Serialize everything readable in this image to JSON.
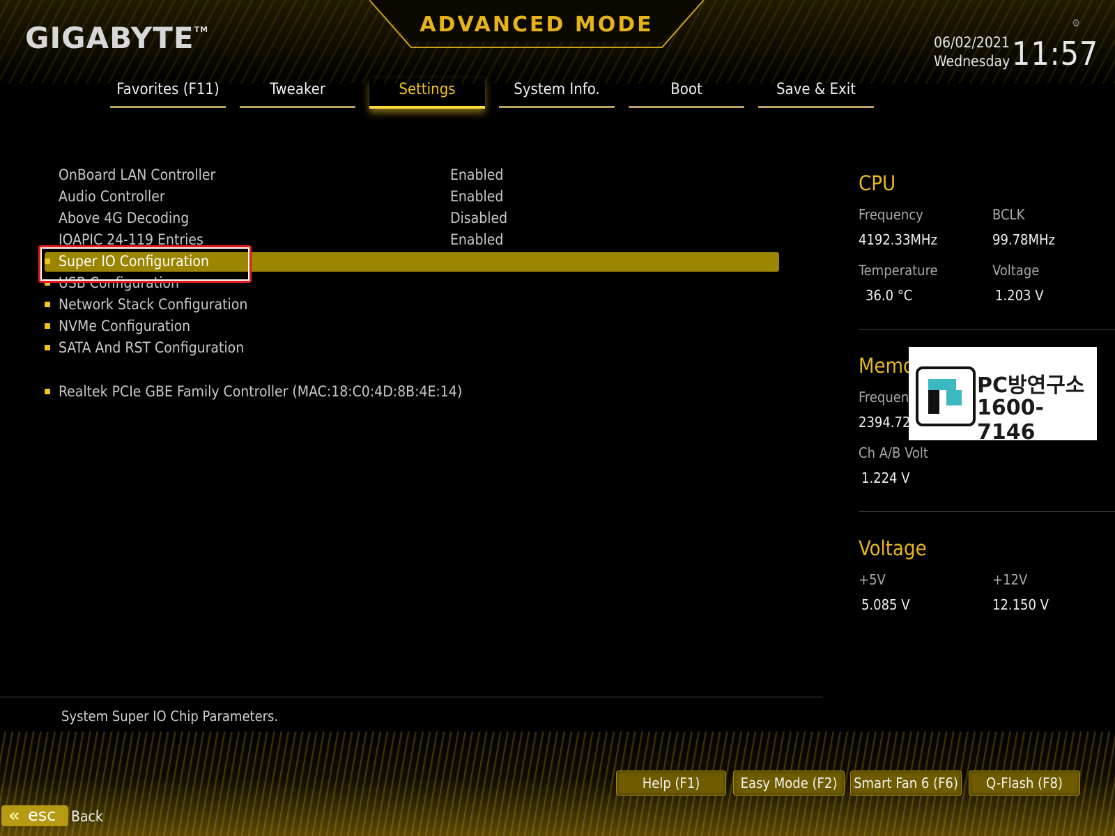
{
  "header": {
    "brand": "GIGABYTE",
    "brand_tm": "TM",
    "mode_title": "ADVANCED MODE",
    "date": "06/02/2021",
    "weekday": "Wednesday",
    "time": "11:57",
    "settings_icon": "gear-icon"
  },
  "tabs": [
    {
      "label": "Favorites (F11)",
      "active": false
    },
    {
      "label": "Tweaker",
      "active": false
    },
    {
      "label": "Settings",
      "active": true
    },
    {
      "label": "System Info.",
      "active": false
    },
    {
      "label": "Boot",
      "active": false
    },
    {
      "label": "Save & Exit",
      "active": false
    }
  ],
  "settings": {
    "items": [
      {
        "label": "OnBoard LAN Controller",
        "value": "Enabled"
      },
      {
        "label": "Audio Controller",
        "value": "Enabled"
      },
      {
        "label": "Above 4G Decoding",
        "value": "Disabled"
      },
      {
        "label": "IOAPIC 24-119 Entries",
        "value": "Enabled"
      },
      {
        "label": "Super IO Configuration",
        "selected": true
      },
      {
        "label": "USB Configuration"
      },
      {
        "label": "Network Stack Configuration"
      },
      {
        "label": "NVMe Configuration"
      },
      {
        "label": "SATA And RST Configuration"
      },
      {
        "label": "Realtek PCIe GBE Family Controller (MAC:18:C0:4D:8B:4E:14)"
      }
    ]
  },
  "help_text": "System Super IO Chip Parameters.",
  "cpu": {
    "title": "CPU",
    "frequency_label": "Frequency",
    "frequency_value": "4192.33MHz",
    "bclk_label": "BCLK",
    "bclk_value": "99.78MHz",
    "temperature_label": "Temperature",
    "temperature_value": "36.0 °C",
    "voltage_label": "Voltage",
    "voltage_value": "1.203 V"
  },
  "memory": {
    "title": "Memo",
    "frequency_label": "Frequen",
    "frequency_value": "2394.72",
    "ch_volt_label": "Ch A/B Volt",
    "ch_volt_value": "1.224 V"
  },
  "voltage": {
    "title": "Voltage",
    "v5_label": "+5V",
    "v5_value": "5.085 V",
    "v12_label": "+12V",
    "v12_value": "12.150 V"
  },
  "watermark": {
    "line1": "PC방연구소",
    "line2": "1600-7146"
  },
  "footer": {
    "help": "Help (F1)",
    "easy_mode": "Easy Mode (F2)",
    "smart_fan": "Smart Fan 6 (F6)",
    "qflash": "Q-Flash (F8)",
    "esc": "esc",
    "back": "Back"
  },
  "colors": {
    "accent": "#f2c419",
    "highlight_bar": "#9c8500",
    "focus_border": "#e01a1a"
  }
}
